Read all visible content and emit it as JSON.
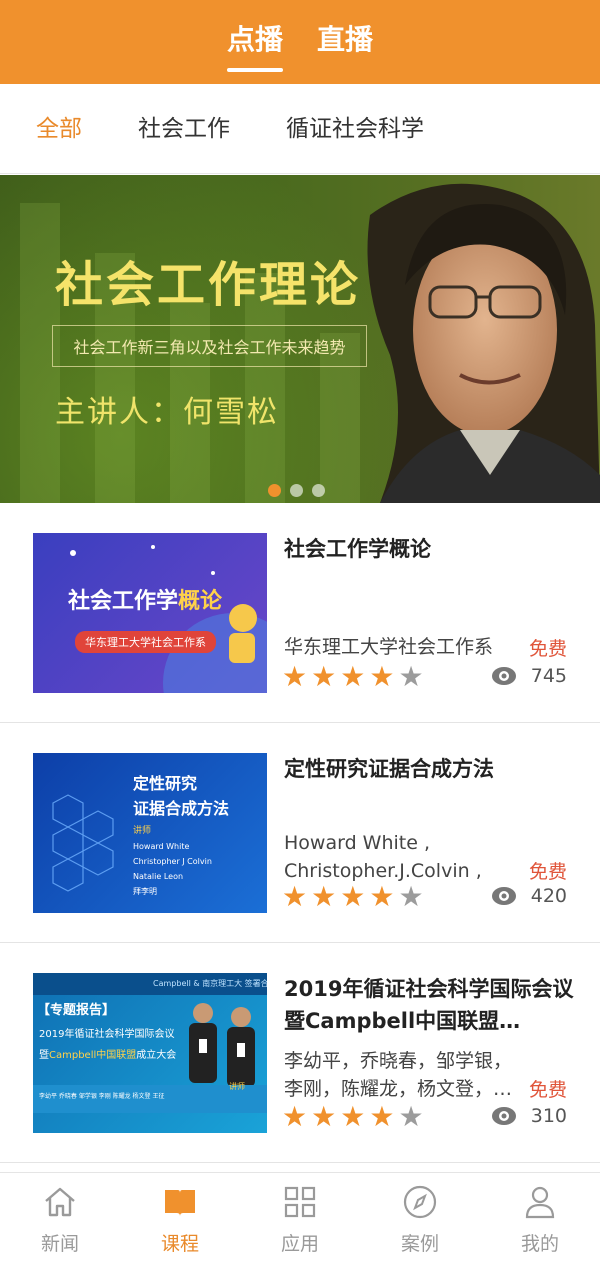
{
  "top_tabs": [
    {
      "label": "点播",
      "active": true
    },
    {
      "label": "直播",
      "active": false
    }
  ],
  "categories": [
    {
      "label": "全部",
      "active": true
    },
    {
      "label": "社会工作",
      "active": false
    },
    {
      "label": "循证社会科学",
      "active": false
    }
  ],
  "banner": {
    "title": "社会工作理论",
    "subtitle": "社会工作新三角以及社会工作未来趋势",
    "speaker": "主讲人：何雪松",
    "dots_count": 3,
    "active_dot": 0
  },
  "courses": [
    {
      "title": "社会工作学概论",
      "author": "华东理工大学社会工作系",
      "price": "免费",
      "rating": 4,
      "views": "745",
      "thumb": {
        "heading_a": "社会工作学",
        "heading_b": "概论",
        "tag": "华东理工大学社会工作系"
      }
    },
    {
      "title": "定性研究证据合成方法",
      "author": "Howard White , Christopher.J.Colvin , Nat…",
      "price": "免费",
      "rating": 4,
      "views": "420",
      "thumb": {
        "line1": "定性研究",
        "line2": "证据合成方法",
        "lecturer_label": "讲师",
        "names": [
          "Howard White",
          "Christopher J Colvin",
          "Natalie Leon",
          "拜李明"
        ]
      }
    },
    {
      "title": "2019年循证社会科学国际会议暨Campbell中国联盟…",
      "author": "李幼平，乔晓春，邹学银，李刚，陈耀龙，杨文登，…",
      "price": "免费",
      "rating": 4,
      "views": "310",
      "thumb": {
        "tag": "【专题报告】",
        "line1": "2019年循证社会科学国际会议",
        "line2a": "暨",
        "line2b": "Campbell中国联盟",
        "line2c": "成立大会",
        "lecturer_label": "讲师",
        "names": "李幼平 乔晓春 邹学银 李刚 陈耀龙 杨文登 王征",
        "banner_text": "Campbell & 南京理工大 签署合作备忘录"
      }
    }
  ],
  "bottom_nav": [
    {
      "label": "新闻",
      "icon": "home-icon",
      "active": false
    },
    {
      "label": "课程",
      "icon": "book-icon",
      "active": true
    },
    {
      "label": "应用",
      "icon": "grid-icon",
      "active": false
    },
    {
      "label": "案例",
      "icon": "compass-icon",
      "active": false
    },
    {
      "label": "我的",
      "icon": "user-icon",
      "active": false
    }
  ],
  "colors": {
    "primary": "#f0912d",
    "accent_text": "#e98a2b",
    "price": "#e0553a",
    "star_on": "#f0912d",
    "star_off": "#9c9c9c"
  }
}
